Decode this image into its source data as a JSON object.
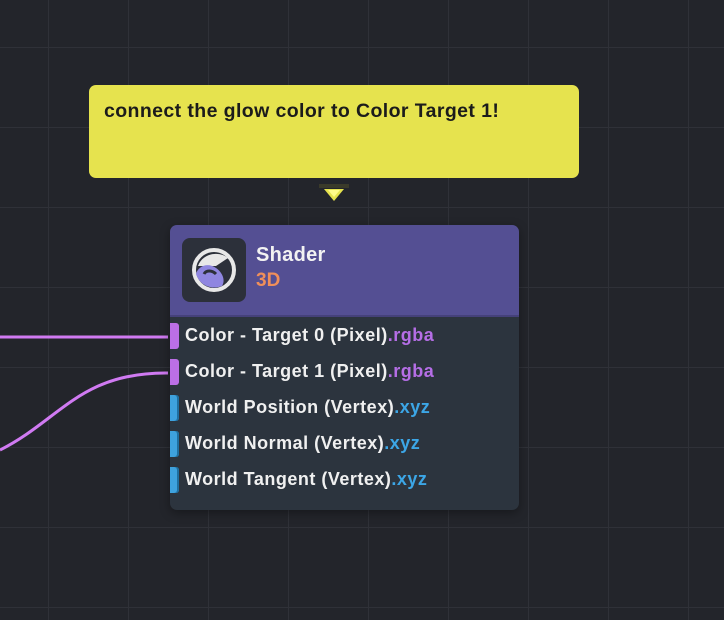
{
  "comment": {
    "text": "connect the glow color to Color Target 1!",
    "color": "#e6e34e"
  },
  "node": {
    "title": "Shader",
    "subtitle": "3D",
    "icon": "shader-sphere-icon",
    "header_color": "#544f93",
    "ports": [
      {
        "label": "Color - Target 0 (Pixel)",
        "swizzle": ".rgba",
        "type": "color",
        "connected": true
      },
      {
        "label": "Color - Target 1 (Pixel)",
        "swizzle": ".rgba",
        "type": "color",
        "connected": true
      },
      {
        "label": "World Position (Vertex)",
        "swizzle": ".xyz",
        "type": "vector",
        "connected": false
      },
      {
        "label": "World Normal (Vertex)",
        "swizzle": ".xyz",
        "type": "vector",
        "connected": false
      },
      {
        "label": "World Tangent (Vertex)",
        "swizzle": ".xyz",
        "type": "vector",
        "connected": false
      }
    ]
  },
  "colors": {
    "background": "#23252b",
    "wire": "#d07af2",
    "color_socket": "#bb6fe6",
    "vector_socket": "#3ea2de"
  }
}
